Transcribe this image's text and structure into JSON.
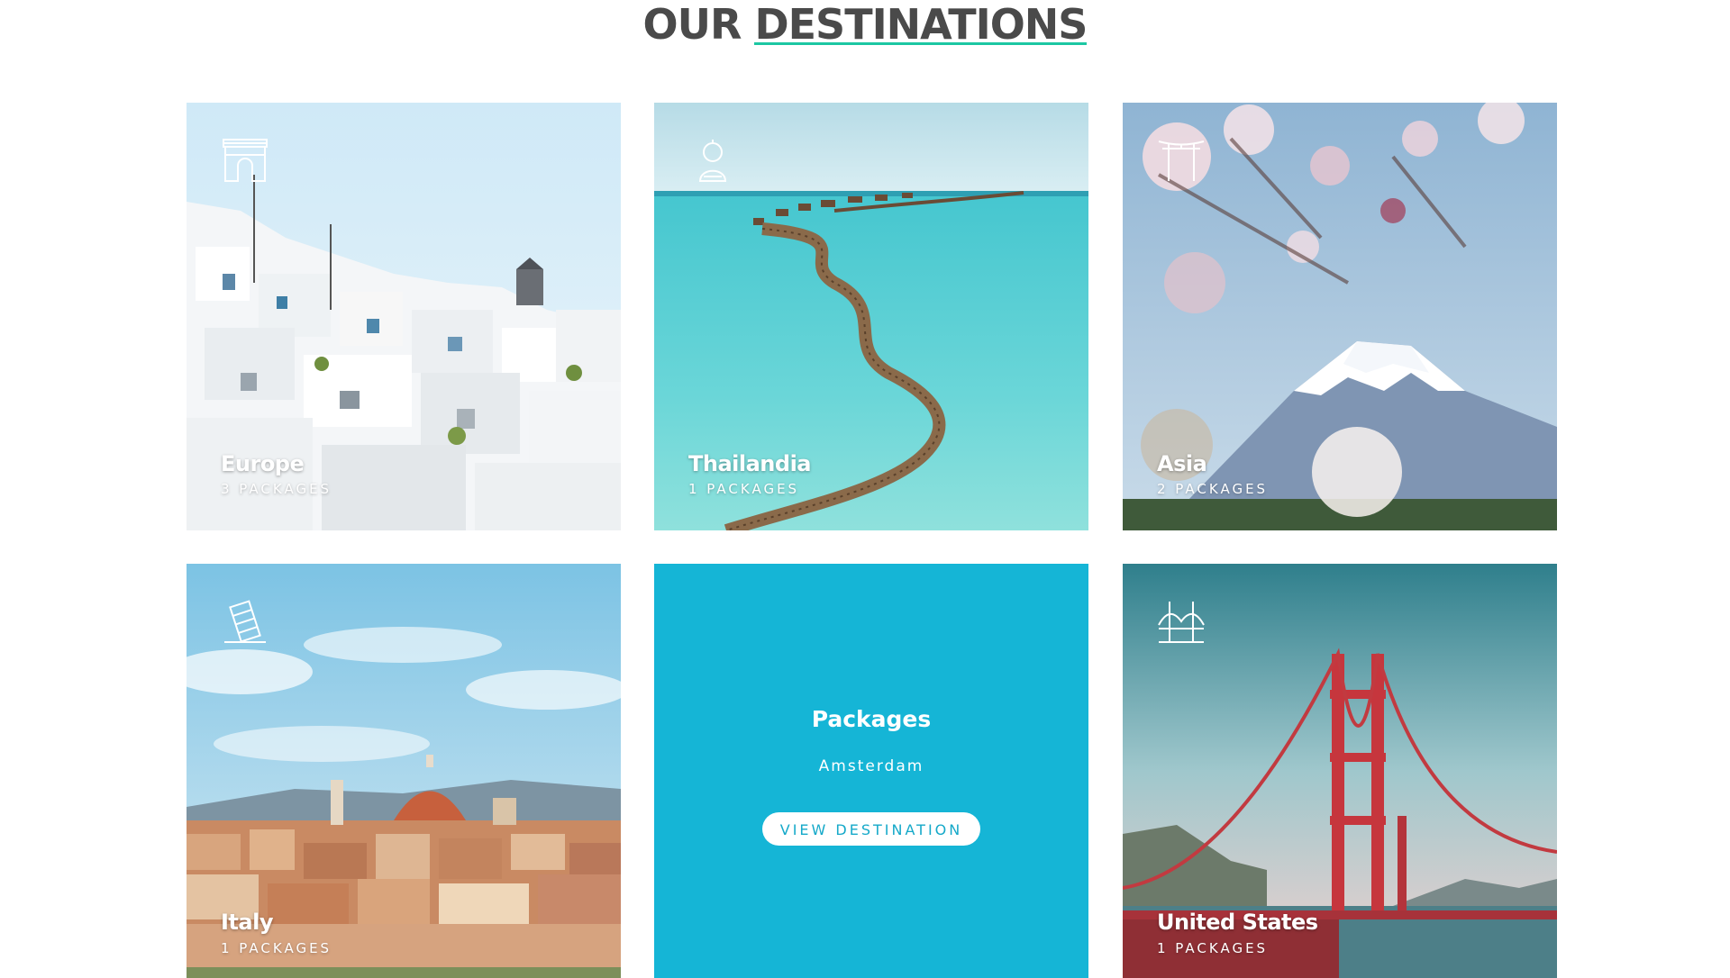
{
  "section": {
    "title_part1": "OUR",
    "title_part2": "DESTINATIONS",
    "accent_color": "#1cc7a3"
  },
  "destinations": [
    {
      "name": "Europe",
      "count": "3 PACKAGES",
      "icon": "arch-icon"
    },
    {
      "name": "Thailandia",
      "count": "1 PACKAGES",
      "icon": "buddha-icon"
    },
    {
      "name": "Asia",
      "count": "2 PACKAGES",
      "icon": "torii-gate-icon"
    },
    {
      "name": "Italy",
      "count": "1 PACKAGES",
      "icon": "leaning-tower-icon"
    },
    {
      "name": "United States",
      "count": "1 PACKAGES",
      "icon": "bridge-icon"
    }
  ],
  "packages_card": {
    "title": "Packages",
    "subtitle": "Amsterdam",
    "button_label": "VIEW DESTINATION",
    "background_color": "#15b5d6"
  }
}
